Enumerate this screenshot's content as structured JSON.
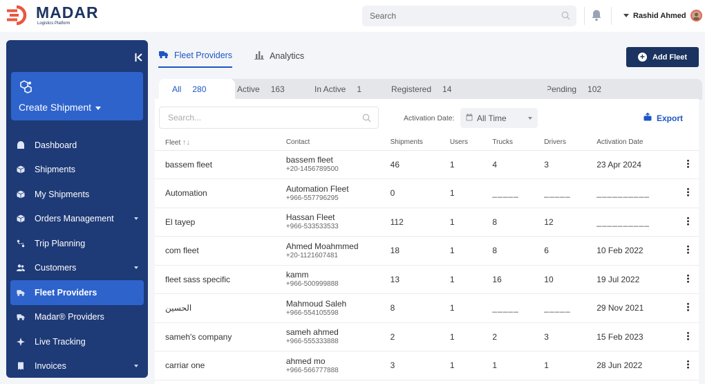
{
  "app": {
    "logo_name": "MADAR",
    "logo_sub": "Logistics Platform",
    "search_placeholder": "Search",
    "user_name": "Rashid Ahmed"
  },
  "sidebar": {
    "create_label": "Create Shipment",
    "items": [
      {
        "label": "Dashboard",
        "icon": "dashboard-icon",
        "dropdown": false,
        "active": false
      },
      {
        "label": "Shipments",
        "icon": "box-icon",
        "dropdown": false,
        "active": false
      },
      {
        "label": "My Shipments",
        "icon": "box-icon",
        "dropdown": false,
        "active": false
      },
      {
        "label": "Orders Management",
        "icon": "box-icon",
        "dropdown": true,
        "active": false
      },
      {
        "label": "Trip Planning",
        "icon": "route-icon",
        "dropdown": false,
        "active": false
      },
      {
        "label": "Customers",
        "icon": "users-icon",
        "dropdown": true,
        "active": false
      },
      {
        "label": "Fleet Providers",
        "icon": "truck-icon",
        "dropdown": false,
        "active": true
      },
      {
        "label": "Madar® Providers",
        "icon": "truck-icon",
        "dropdown": false,
        "active": false
      },
      {
        "label": "Live Tracking",
        "icon": "tracking-icon",
        "dropdown": false,
        "active": false
      },
      {
        "label": "Invoices",
        "icon": "invoice-icon",
        "dropdown": true,
        "active": false
      }
    ]
  },
  "main": {
    "tabs": [
      {
        "label": "Fleet Providers",
        "active": true
      },
      {
        "label": "Analytics",
        "active": false
      }
    ],
    "add_button": "Add Fleet",
    "status_tabs": [
      {
        "label": "All",
        "count": "280",
        "active": true
      },
      {
        "label": "Active",
        "count": "163",
        "active": false
      },
      {
        "label": "In Active",
        "count": "1",
        "active": false
      },
      {
        "label": "Registered",
        "count": "14",
        "active": false
      },
      {
        "label": "Pending",
        "count": "102",
        "active": false
      }
    ],
    "table_search_placeholder": "Search...",
    "activation_label": "Activation Date:",
    "activation_value": "All Time",
    "export_label": "Export",
    "columns": [
      "Fleet",
      "Contact",
      "Shipments",
      "Users",
      "Trucks",
      "Drivers",
      "Activation Date"
    ],
    "rows": [
      {
        "fleet": "bassem fleet",
        "contact_name": "bassem fleet",
        "contact_phone": "+20-1456789500",
        "shipments": "46",
        "users": "1",
        "trucks": "4",
        "drivers": "3",
        "date": "23 Apr 2024"
      },
      {
        "fleet": "Automation",
        "contact_name": "Automation Fleet",
        "contact_phone": "+966-557796295",
        "shipments": "0",
        "users": "1",
        "trucks": "_____",
        "drivers": "_____",
        "date": "__________"
      },
      {
        "fleet": "El tayep",
        "contact_name": "Hassan Fleet",
        "contact_phone": "+966-533533533",
        "shipments": "112",
        "users": "1",
        "trucks": "8",
        "drivers": "12",
        "date": "__________"
      },
      {
        "fleet": "com fleet",
        "contact_name": "Ahmed Moahmmed",
        "contact_phone": "+20-1121607481",
        "shipments": "18",
        "users": "1",
        "trucks": "8",
        "drivers": "6",
        "date": "10 Feb 2022"
      },
      {
        "fleet": "fleet sass specific",
        "contact_name": "kamm",
        "contact_phone": "+966-500999888",
        "shipments": "13",
        "users": "1",
        "trucks": "16",
        "drivers": "10",
        "date": "19 Jul 2022"
      },
      {
        "fleet": "الحسين",
        "contact_name": "Mahmoud Saleh",
        "contact_phone": "+966-554105598",
        "shipments": "8",
        "users": "1",
        "trucks": "_____",
        "drivers": "_____",
        "date": "29 Nov 2021"
      },
      {
        "fleet": "sameh's company",
        "contact_name": "sameh ahmed",
        "contact_phone": "+966-555333888",
        "shipments": "2",
        "users": "1",
        "trucks": "2",
        "drivers": "3",
        "date": "15 Feb 2023"
      },
      {
        "fleet": "carriar one",
        "contact_name": "ahmed mo",
        "contact_phone": "+966-566777888",
        "shipments": "3",
        "users": "1",
        "trucks": "1",
        "drivers": "1",
        "date": "28 Jun 2022"
      }
    ]
  },
  "colors": {
    "sidebar_bg": "#1e3a77",
    "accent": "#2e63cc",
    "brand_dark": "#1a3360",
    "link": "#1d56c4",
    "logo_orange": "#e8573f"
  }
}
